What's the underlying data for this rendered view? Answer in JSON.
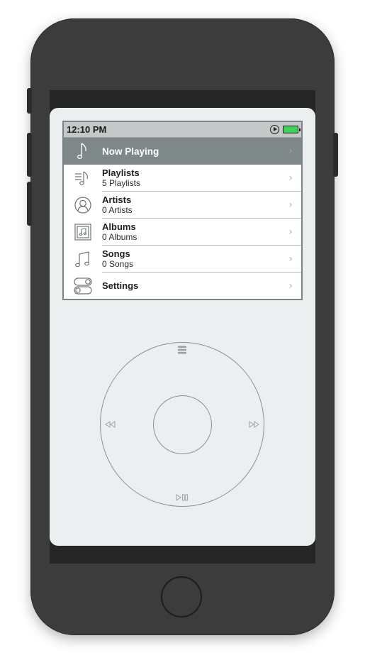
{
  "status_bar": {
    "time": "12:10 PM",
    "play_indicator_icon": "play-circle-icon",
    "battery_icon": "battery-icon",
    "battery_color": "#3fd25a"
  },
  "menu": {
    "items": [
      {
        "title": "Now Playing",
        "subtitle": "",
        "icon": "music-note-icon",
        "selected": true
      },
      {
        "title": "Playlists",
        "subtitle": "5 Playlists",
        "icon": "playlist-icon",
        "selected": false
      },
      {
        "title": "Artists",
        "subtitle": "0 Artists",
        "icon": "artist-icon",
        "selected": false
      },
      {
        "title": "Albums",
        "subtitle": "0 Albums",
        "icon": "album-icon",
        "selected": false
      },
      {
        "title": "Songs",
        "subtitle": "0 Songs",
        "icon": "songs-icon",
        "selected": false
      },
      {
        "title": "Settings",
        "subtitle": "",
        "icon": "settings-toggle-icon",
        "selected": false
      }
    ],
    "chevron": "›"
  },
  "colors": {
    "selected_row": "#7e8888",
    "status_bar": "#c4c8c8",
    "app_background": "#eceff0",
    "wheel_stroke": "#8a9292",
    "phone_body": "#3c3c3c"
  },
  "click_wheel": {
    "menu_icon": "menu-bars-icon",
    "previous_icon": "rewind-icon",
    "next_icon": "fast-forward-icon",
    "play_pause_icon": "play-pause-icon"
  }
}
